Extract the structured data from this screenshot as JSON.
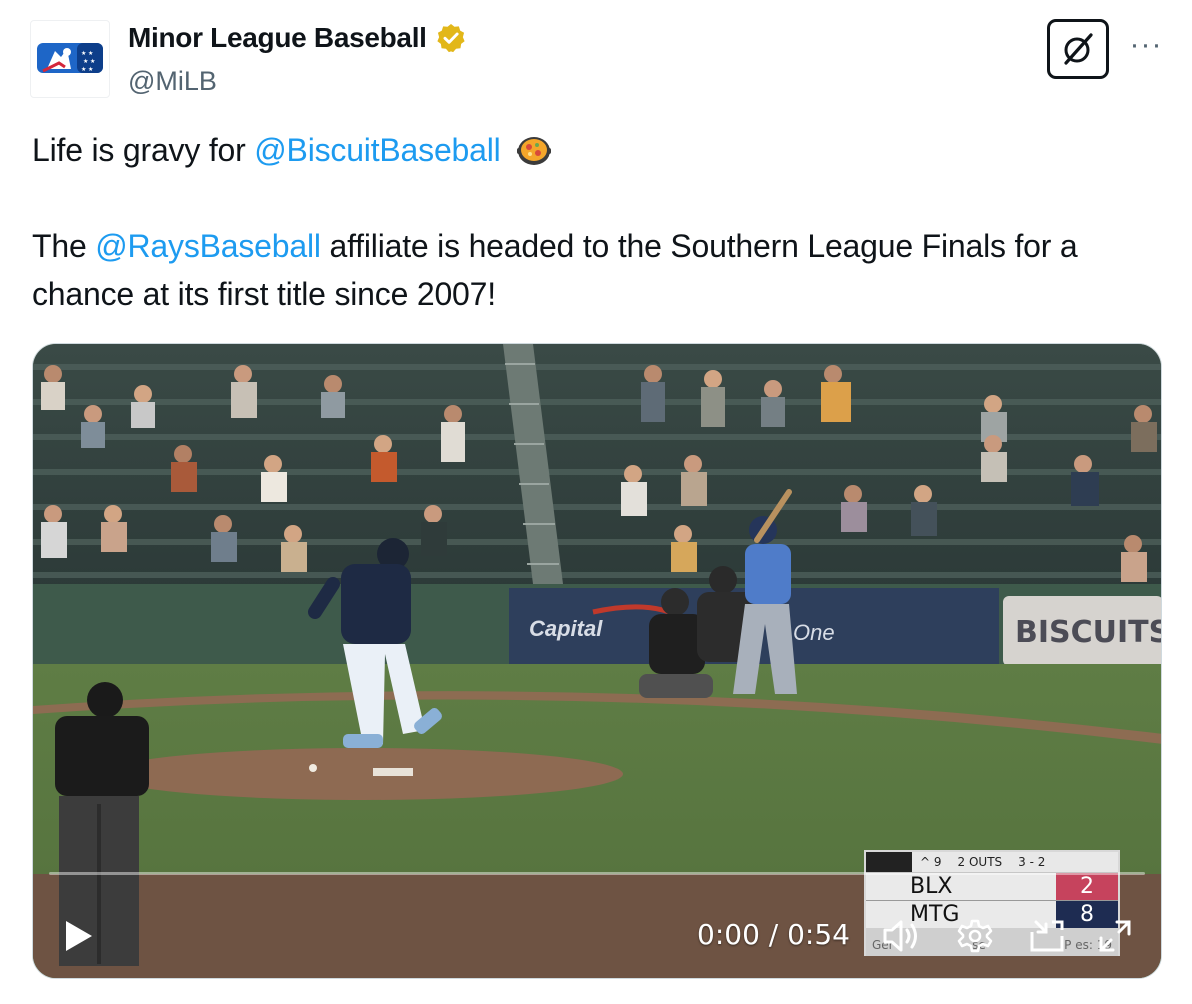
{
  "author": {
    "name": "Minor League Baseball",
    "handle": "@MiLB",
    "verified": true,
    "verified_badge_color": "#e2b719",
    "avatar_icon": "milb-logo-icon"
  },
  "actions": {
    "grok_icon": "grok-icon",
    "more_label": "···"
  },
  "tweet": {
    "line1_prefix": "Life is gravy for ",
    "line1_mention": "@BiscuitBaseball",
    "line1_emoji": "shallow-pan-of-food-emoji",
    "line2_prefix": "The ",
    "line2_mention": "@RaysBaseball",
    "line2_suffix": " affiliate is headed to the Southern League Finals for a chance at its first title since 2007!"
  },
  "video": {
    "scorebug": {
      "inning": "^ 9",
      "outs": "2 OUTS",
      "count": "3 - 2",
      "team1": "BLX",
      "score1": "2",
      "team2": "MTG",
      "score2": "8",
      "footer_left": "Ger",
      "footer_mid": "se",
      "footer_right": "P     es: 19"
    },
    "wall_text": "BISCUITSB",
    "sponsor_text_left": "Capital",
    "sponsor_text_right": "One",
    "time_display": "0:00 / 0:54",
    "progress_fraction": 0,
    "accent_color": "#1d9bf0",
    "play_icon": "play-icon",
    "mute_icon": "speaker-icon",
    "settings_icon": "gear-icon",
    "dock_icon": "picture-in-picture-icon",
    "fullscreen_icon": "fullscreen-icon"
  },
  "colors": {
    "mention": "#1d9bf0",
    "handle": "#536471",
    "text": "#0f1419"
  }
}
